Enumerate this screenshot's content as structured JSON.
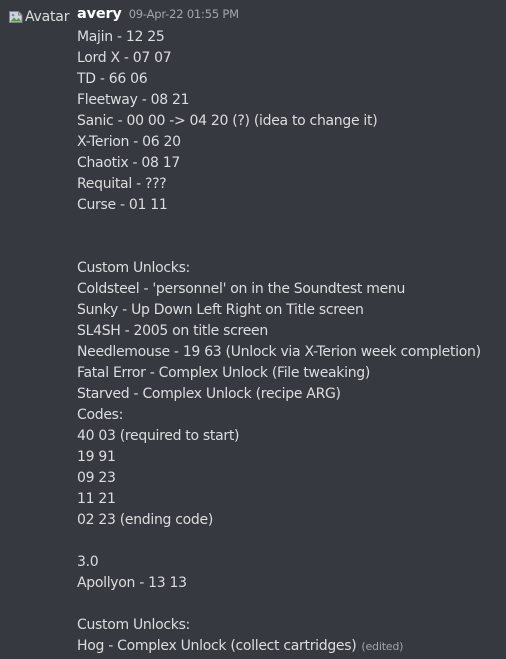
{
  "avatar": {
    "alt": "Avatar",
    "icon": "broken-image-icon"
  },
  "message": {
    "username": "avery",
    "timestamp": "09-Apr-22 01:55 PM",
    "lines": [
      "Majin - 12 25",
      "Lord X - 07 07",
      "TD - 66 06",
      "Fleetway - 08 21",
      "Sanic - 00 00 -> 04 20 (?) (idea to change it)",
      "X-Terion - 06 20",
      "Chaotix - 08 17",
      "Requital - ???",
      "Curse - 01 11",
      "",
      "",
      "Custom Unlocks:",
      "Coldsteel - 'personnel' on in the Soundtest menu",
      "Sunky - Up Down Left Right on Title screen",
      "SL4SH - 2005 on title screen",
      "Needlemouse - 19 63 (Unlock via X-Terion week completion)",
      "Fatal Error - Complex Unlock (File tweaking)",
      "Starved - Complex Unlock (recipe ARG)",
      "Codes:",
      "40 03 (required to start)",
      "19 91",
      "09 23",
      "11 21",
      "02 23 (ending code)",
      "",
      "3.0",
      "Apollyon - 13 13",
      "",
      "Custom Unlocks:",
      "Hog - Complex Unlock (collect cartridges)"
    ],
    "edited_label": "(edited)"
  }
}
